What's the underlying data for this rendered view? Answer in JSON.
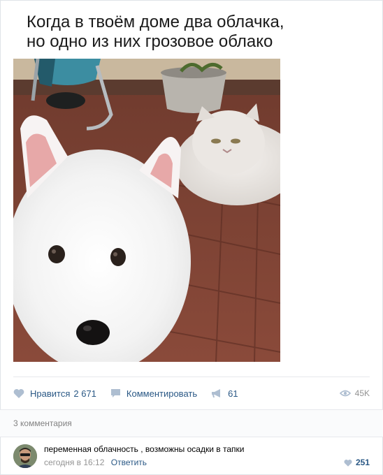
{
  "meme": {
    "caption_line1": "Когда в твоём доме два облачка,",
    "caption_line2": "но одно из них грозовое облако"
  },
  "post_actions": {
    "like_label": "Нравится",
    "like_count": "2 671",
    "comment_label": "Комментировать",
    "share_count": "61",
    "views_count": "45K"
  },
  "comments": {
    "header": "3 комментария",
    "items": [
      {
        "text": "переменная облачность , возможны осадки в тапки",
        "time": "сегодня в 16:12",
        "reply_label": "Ответить",
        "likes": "251"
      }
    ]
  },
  "icons": {
    "like": "heart-icon",
    "comment": "comment-icon",
    "share": "megaphone-icon",
    "views": "eye-icon",
    "comment_like": "heart-icon"
  },
  "colors": {
    "link": "#2a5885",
    "icon": "#aebed1",
    "muted": "#939393",
    "border": "#e7e8ec"
  }
}
